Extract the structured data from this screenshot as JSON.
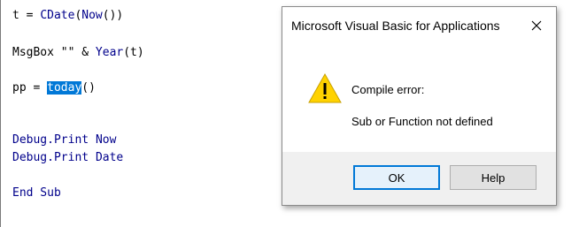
{
  "editor": {
    "lines": {
      "l1_a": "t = ",
      "l1_b": "CDate",
      "l1_c": "(",
      "l1_d": "Now",
      "l1_e": "())",
      "l2_a": "MsgBox \"\" & ",
      "l2_b": "Year",
      "l2_c": "(t)",
      "l3_a": "pp = ",
      "l3_sel": "today",
      "l3_c": "()",
      "l4_a": "Debug",
      "l4_b": ".Print ",
      "l4_c": "Now",
      "l5_a": "Debug",
      "l5_b": ".Print ",
      "l5_c": "Date",
      "l6_a": "End Sub"
    }
  },
  "dialog": {
    "title": "Microsoft Visual Basic for Applications",
    "close_symbol": "✕",
    "icon": "warning-icon",
    "heading": "Compile error:",
    "message": "Sub or Function not defined",
    "ok_label": "OK",
    "help_label": "Help"
  },
  "colors": {
    "keyword": "#00008b",
    "selection": "#0078d7",
    "ok_border": "#0078d7",
    "footer_bg": "#f0f0f0",
    "warning_fill": "#ffd200"
  }
}
